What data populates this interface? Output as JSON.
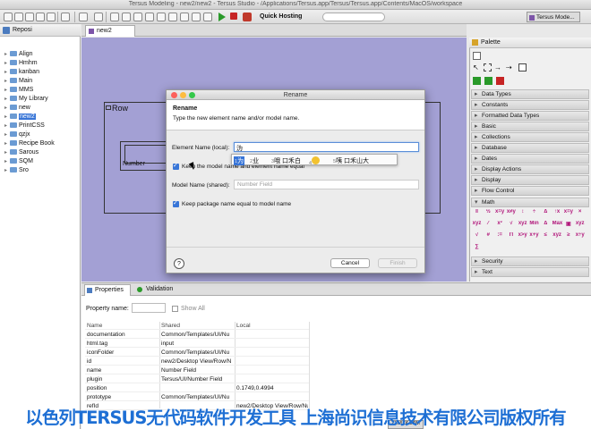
{
  "window": {
    "title": "Tersus Modeling - new2/new2 - Tersus Studio - /Applications/Tersus.app/Tersus/Tersus.app/Contents/MacOS/workspace"
  },
  "toolbar": {
    "quick_hosting_label": "Quick Hosting",
    "perspective_label": "Tersus Mode..."
  },
  "repository": {
    "tab_label": "Reposi",
    "items": [
      {
        "label": "Align"
      },
      {
        "label": "Hmhm"
      },
      {
        "label": "kanban"
      },
      {
        "label": "Main"
      },
      {
        "label": "MMS"
      },
      {
        "label": "My Library"
      },
      {
        "label": "new"
      },
      {
        "label": "new2",
        "selected": true
      },
      {
        "label": "PrintCSS"
      },
      {
        "label": "qzjx"
      },
      {
        "label": "Recipe Book"
      },
      {
        "label": "Sarous"
      },
      {
        "label": "SQM"
      },
      {
        "label": "Sro"
      }
    ]
  },
  "editor": {
    "tab_label": "new2",
    "row_label": "Row",
    "field_label": "Number"
  },
  "palette": {
    "label": "Palette",
    "groups": [
      {
        "label": "Data Types"
      },
      {
        "label": "Constants"
      },
      {
        "label": "Formatted Data Types"
      },
      {
        "label": "Basic"
      },
      {
        "label": "Collections"
      },
      {
        "label": "Database"
      },
      {
        "label": "Dates"
      },
      {
        "label": "Display Actions"
      },
      {
        "label": "Display"
      },
      {
        "label": "Flow Control"
      },
      {
        "label": "Math",
        "open": true
      },
      {
        "label": "Security"
      },
      {
        "label": "Text"
      }
    ]
  },
  "properties": {
    "tab_label": "Properties",
    "validation_label": "Validation",
    "property_name_label": "Property name:",
    "show_all_label": "Show All",
    "columns": [
      "Name",
      "Shared",
      "Local"
    ],
    "rows": [
      {
        "name": "documentation",
        "shared": "Common/Templates/UI/Nu",
        "local": ""
      },
      {
        "name": "html.tag",
        "shared": "input",
        "local": ""
      },
      {
        "name": "iconFolder",
        "shared": "Common/Templates/UI/Nu",
        "local": ""
      },
      {
        "name": "id",
        "shared": "new2/Desktop View/Row/N",
        "local": ""
      },
      {
        "name": "name",
        "shared": "Number Field",
        "local": ""
      },
      {
        "name": "plugin",
        "shared": "Tersus/UI/Number Field",
        "local": ""
      },
      {
        "name": "position",
        "shared": "",
        "local": "0.1749,0.4994"
      },
      {
        "name": "prototype",
        "shared": "Common/Templates/UI/Nu",
        "local": ""
      },
      {
        "name": "refId",
        "shared": "",
        "local": "new2/Desktop View/Row/Nu"
      }
    ]
  },
  "dialog": {
    "title": "Rename",
    "heading": "Rename",
    "description": "Type the new element name and/or model name.",
    "element_name_label": "Element Name (local):",
    "element_name_value": "沩",
    "ime_candidates": [
      {
        "num": "1",
        "text": "为"
      },
      {
        "num": "2",
        "text": "业"
      },
      {
        "num": "3",
        "text": "哦 口禾白"
      },
      {
        "num": "4",
        "text": ""
      },
      {
        "num": "5",
        "text": "咦 口禾山大"
      }
    ],
    "keep_model_label": "Keep the model name and element name equal",
    "model_name_label": "Model Name (shared):",
    "model_name_placeholder": "Number Field",
    "keep_package_label": "Keep package name equal to model name",
    "cancel_label": "Cancel",
    "finish_label": "Finish",
    "help_label": "?"
  },
  "statusbar": {
    "memory": "23M of 94M"
  },
  "watermark": {
    "text": "以色列TERSUS无代码软件开发工具 上海尚识信息技术有限公司版权所有"
  },
  "colors": {
    "canvas": "#a3a0d4",
    "selection": "#3875d7",
    "watermark": "#1e6fd4"
  }
}
